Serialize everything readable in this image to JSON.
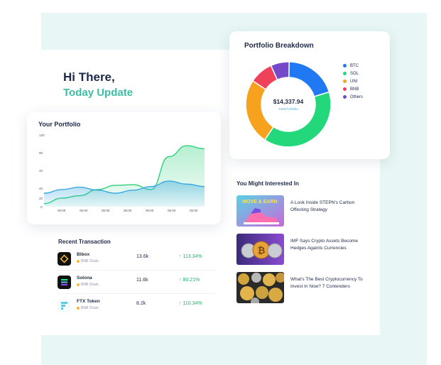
{
  "greeting": {
    "title": "Hi There,",
    "subtitle": "Today Update"
  },
  "portfolio": {
    "title": "Your Portfolio",
    "y_ticks": [
      "120",
      "90",
      "40",
      "40",
      "20",
      "0"
    ],
    "x_ticks": [
      "06:00",
      "06:00",
      "06:00",
      "06:00",
      "06:00",
      "06:00",
      "06:00"
    ]
  },
  "chart_data": {
    "type": "area",
    "title": "Your Portfolio",
    "categories": [
      "",
      "06:00",
      "06:00",
      "06:00",
      "06:00",
      "06:00",
      "06:00",
      "06:00",
      ""
    ],
    "y_tick_labels": [
      "120",
      "90",
      "40",
      "40",
      "20",
      "0"
    ],
    "ylim": [
      0,
      120
    ],
    "grid": false,
    "series": [
      {
        "color": "#2fd17c",
        "values": [
          5,
          14,
          18,
          28,
          35,
          36,
          28,
          82,
          100,
          95
        ]
      },
      {
        "color": "#3aa8e0",
        "values": [
          22,
          28,
          32,
          27,
          22,
          27,
          33,
          42,
          37,
          33
        ]
      }
    ]
  },
  "breakdown": {
    "title": "Portfolio Breakdown",
    "total": "$14,337.94",
    "total_label": "Total Portfolio",
    "segments": [
      {
        "name": "BTC",
        "color": "#2079f2",
        "value": 20
      },
      {
        "name": "SOL",
        "color": "#23d87b",
        "value": 39
      },
      {
        "name": "UNI",
        "color": "#f7a21e",
        "value": 25
      },
      {
        "name": "BNB",
        "color": "#f0415a",
        "value": 9
      },
      {
        "name": "Others",
        "color": "#7548c9",
        "value": 7
      }
    ]
  },
  "transactions": {
    "title": "Recent Transaction",
    "rows": [
      {
        "name": "Bibox",
        "chain": "BNB Chain",
        "amount": "13.6k",
        "change": "113.34%",
        "icon": "bibox-icon",
        "icon_color": "#111111"
      },
      {
        "name": "Solona",
        "chain": "BNB Chain",
        "amount": "11.6k",
        "change": "80.21%",
        "icon": "solana-icon",
        "icon_color": "#111111"
      },
      {
        "name": "FTX Token",
        "chain": "BNB Chain",
        "amount": "8.2k",
        "change": "110.34%",
        "icon": "ftx-icon",
        "icon_color": "#f5fbfd"
      }
    ]
  },
  "news": {
    "title": "You Might Interested In",
    "items": [
      {
        "title": "A Look Inside STEPN's Carbon Offesting Strategy",
        "thumb_label": "MOVE & EARN"
      },
      {
        "title": "IMF Says Crypto Assets Become Hedges Againts Currencies"
      },
      {
        "title": "What's The Best Cryptocurrency To Invest In Now? 7 Contenders"
      }
    ]
  },
  "colors": {
    "accent": "#3dbca6",
    "navy": "#1f2a4a",
    "positive": "#23b26b",
    "background": "#e8f7f5"
  }
}
